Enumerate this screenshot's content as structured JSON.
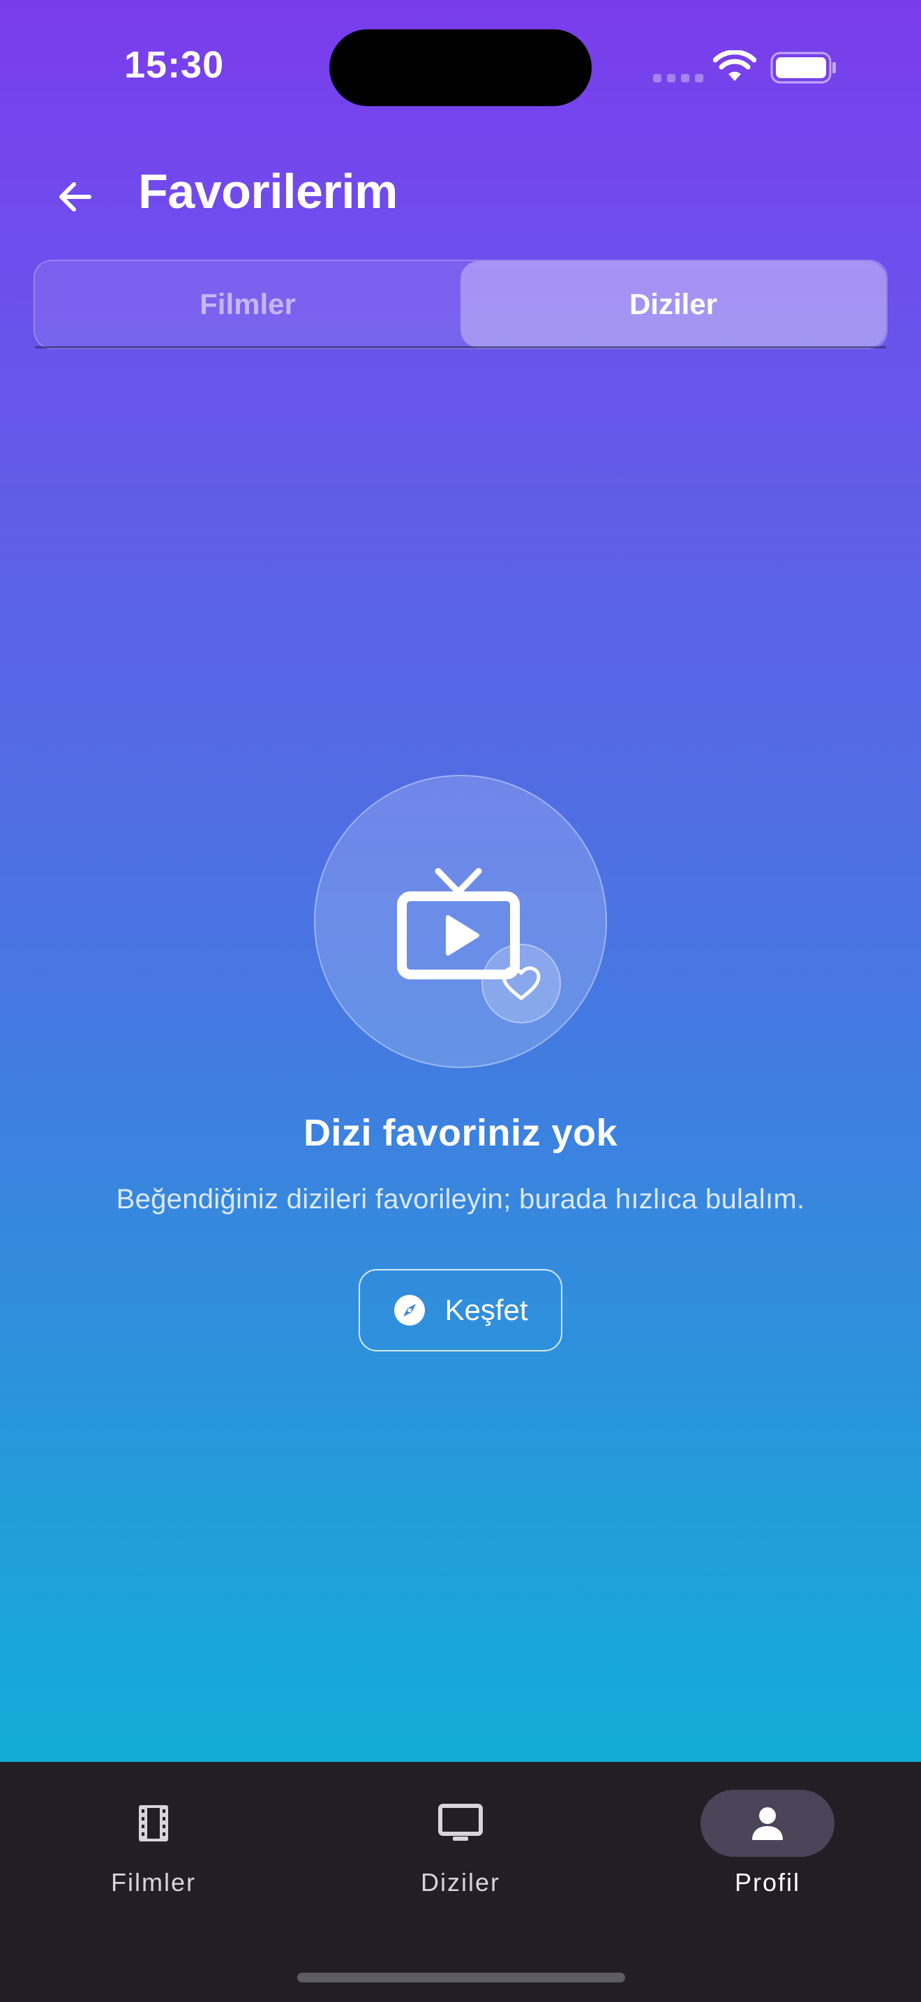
{
  "status_bar": {
    "time": "15:30"
  },
  "header": {
    "title": "Favorilerim",
    "back_icon": "arrow-left-icon"
  },
  "tabs": [
    {
      "label": "Filmler",
      "active": false
    },
    {
      "label": "Diziler",
      "active": true
    }
  ],
  "empty_state": {
    "illustration_icon": "tv-play-icon",
    "badge_icon": "heart-icon",
    "title": "Dizi favoriniz yok",
    "subtitle": "Beğendiğiniz dizileri favorileyin; burada hızlıca bulalım.",
    "button": {
      "label": "Keşfet",
      "icon": "compass-icon"
    }
  },
  "bottom_nav": {
    "items": [
      {
        "label": "Filmler",
        "icon": "film-icon",
        "active": false
      },
      {
        "label": "Diziler",
        "icon": "tv-icon",
        "active": false
      },
      {
        "label": "Profil",
        "icon": "person-icon",
        "active": true
      }
    ]
  },
  "colors": {
    "gradient_top": "#7a3ceb",
    "gradient_bottom": "#08b8d4",
    "nav_background": "#211f25",
    "nav_active_pill": "#4b4459"
  }
}
